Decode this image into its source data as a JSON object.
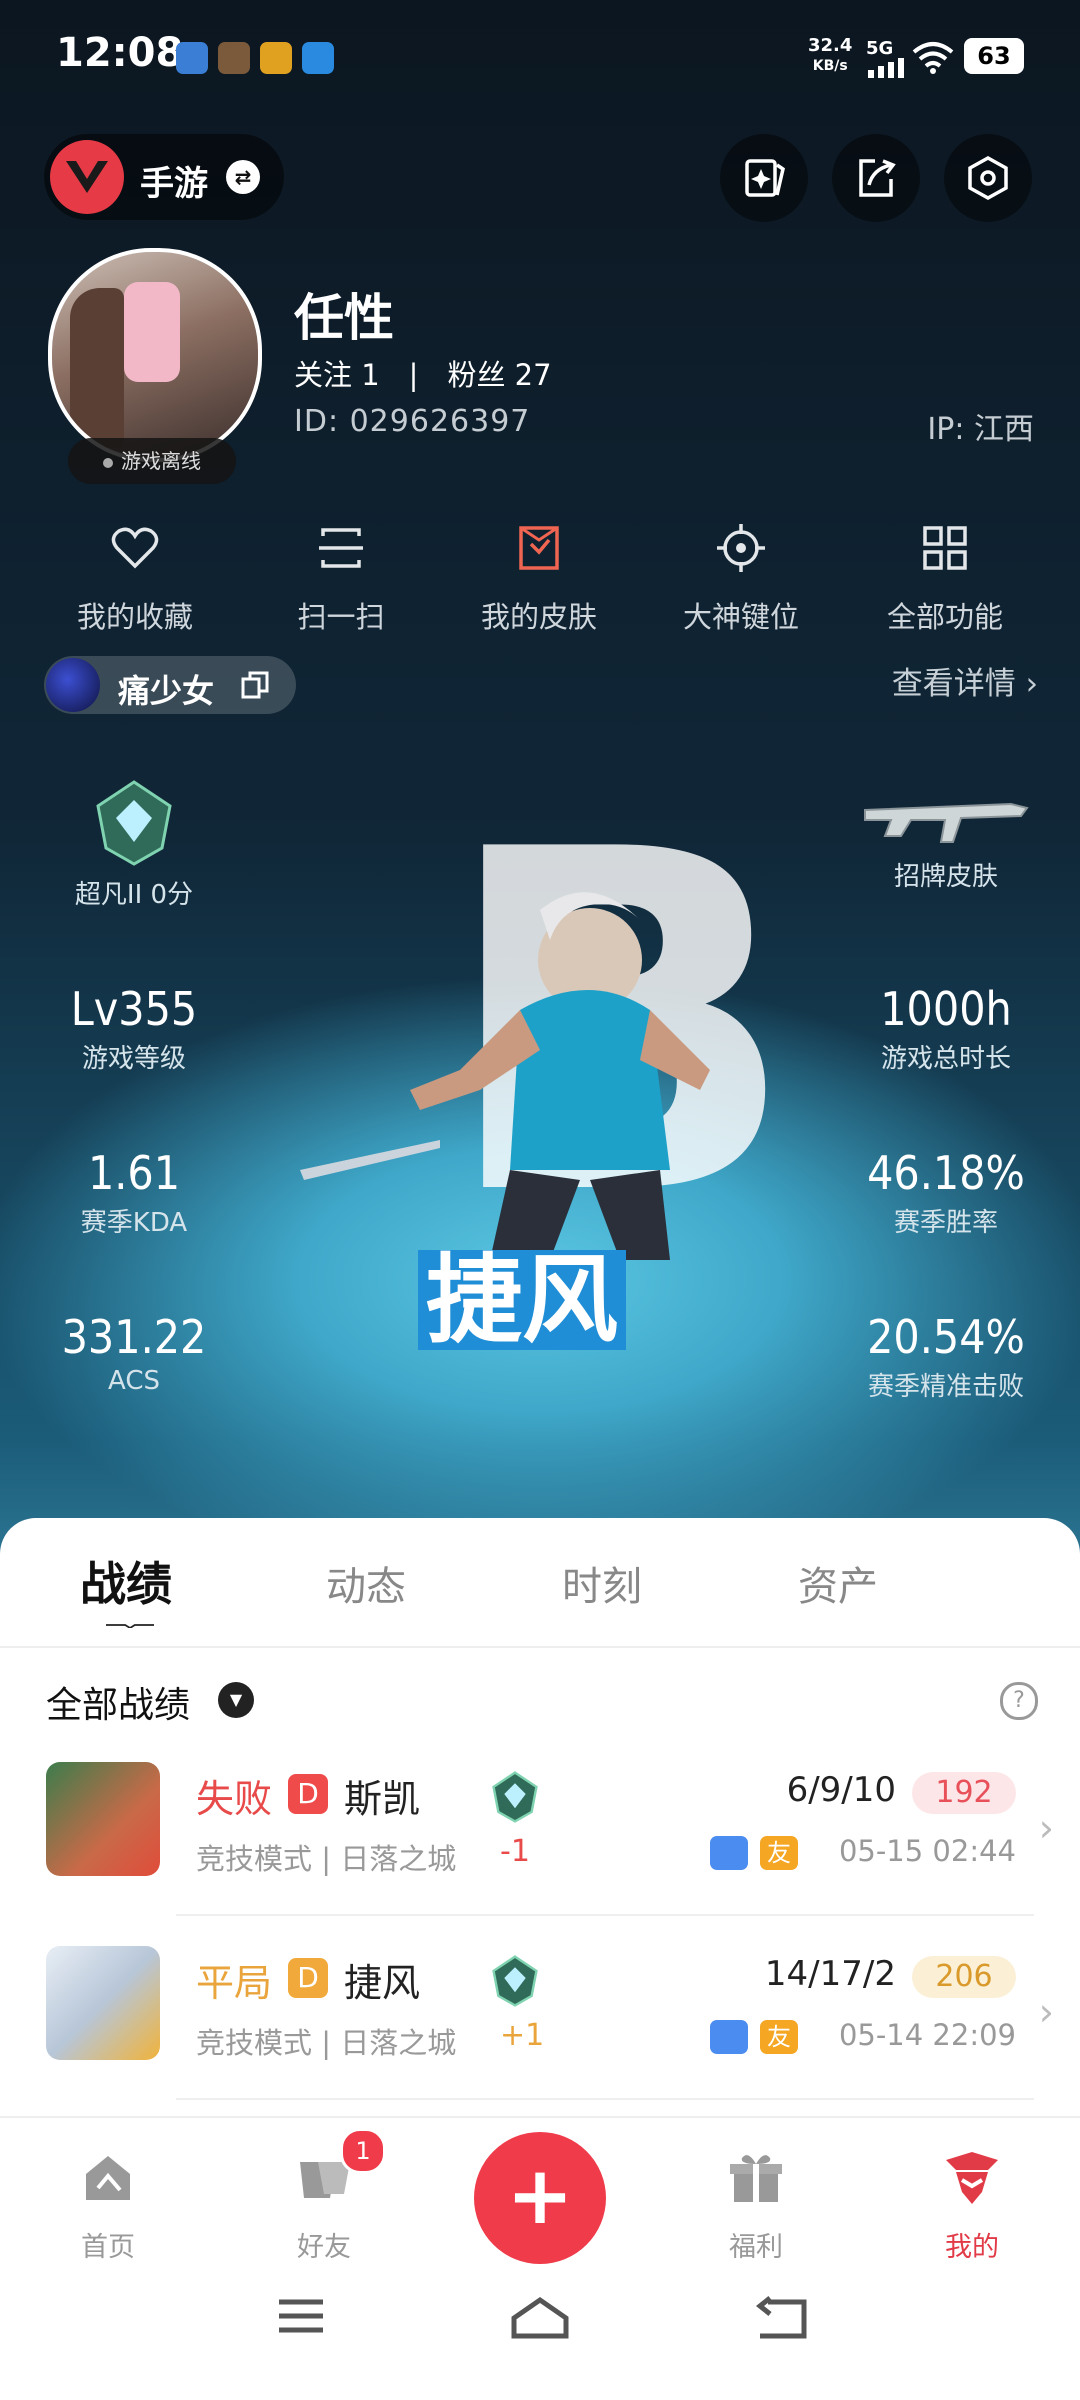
{
  "status_bar": {
    "time": "12:08",
    "net_speed": "32.4",
    "net_unit": "KB/s",
    "signal_type": "5G",
    "battery": "63",
    "app_icon_colors": [
      "#3a7fd5",
      "#7a5a3a",
      "#e0a020",
      "#2a8ae0"
    ]
  },
  "header": {
    "game_switch_label": "手游",
    "buttons": [
      "star-card-icon",
      "share-icon",
      "settings-hex-icon"
    ]
  },
  "profile": {
    "name": "任性",
    "follow_text": "关注 1　|　粉丝 27",
    "id_text": "ID:  029626397",
    "ip_text": "IP:  江西",
    "offline_status": "游戏离线"
  },
  "quick_menu": [
    {
      "label": "我的收藏",
      "icon": "heart-icon"
    },
    {
      "label": "扫一扫",
      "icon": "scan-icon"
    },
    {
      "label": "我的皮肤",
      "icon": "skin-icon"
    },
    {
      "label": "大神键位",
      "icon": "crosshair-icon"
    },
    {
      "label": "全部功能",
      "icon": "grid-icon"
    }
  ],
  "character": {
    "name": "痛少女",
    "detail_link": "查看详情 ›"
  },
  "stats": {
    "rank": "超凡II 0分",
    "signature_skin": "招牌皮肤",
    "level_value": "Lv355",
    "level_label": "游戏等级",
    "hours_value": "1000h",
    "hours_label": "游戏总时长",
    "kda_value": "1.61",
    "kda_label": "赛季KDA",
    "winrate_value": "46.18%",
    "winrate_label": "赛季胜率",
    "acs_value": "331.22",
    "acs_label": "ACS",
    "headshot_value": "20.54%",
    "headshot_label": "赛季精准击败",
    "hero_letter": "B",
    "agent_name": "捷风"
  },
  "tabs": [
    "战绩",
    "动态",
    "时刻",
    "资产"
  ],
  "records": {
    "title": "全部战绩",
    "items": [
      {
        "result": "失败",
        "result_color": "#e84a4a",
        "d": "D",
        "d_color": "#ef4b4b",
        "agent": "斯凯",
        "mode": "竞技模式 | 日落之城",
        "delta": "-1",
        "delta_color": "#e84a4a",
        "kda": "6/9/10",
        "score": "192",
        "score_bg": "#fde6e8",
        "score_color": "#e8505a",
        "time": "05-15 02:44",
        "friend": "友"
      },
      {
        "result": "平局",
        "result_color": "#e9a43b",
        "d": "D",
        "d_color": "#f1a93b",
        "agent": "捷风",
        "mode": "竞技模式 | 日落之城",
        "delta": "+1",
        "delta_color": "#e9a43b",
        "kda": "14/17/2",
        "score": "206",
        "score_bg": "#fbf0d6",
        "score_color": "#d99a2b",
        "time": "05-14 22:09",
        "friend": "友"
      }
    ]
  },
  "bottom_nav": {
    "items": [
      {
        "label": "首页"
      },
      {
        "label": "好友",
        "badge": "1"
      },
      {
        "label": "福利"
      },
      {
        "label": "我的"
      }
    ],
    "add": "+"
  }
}
